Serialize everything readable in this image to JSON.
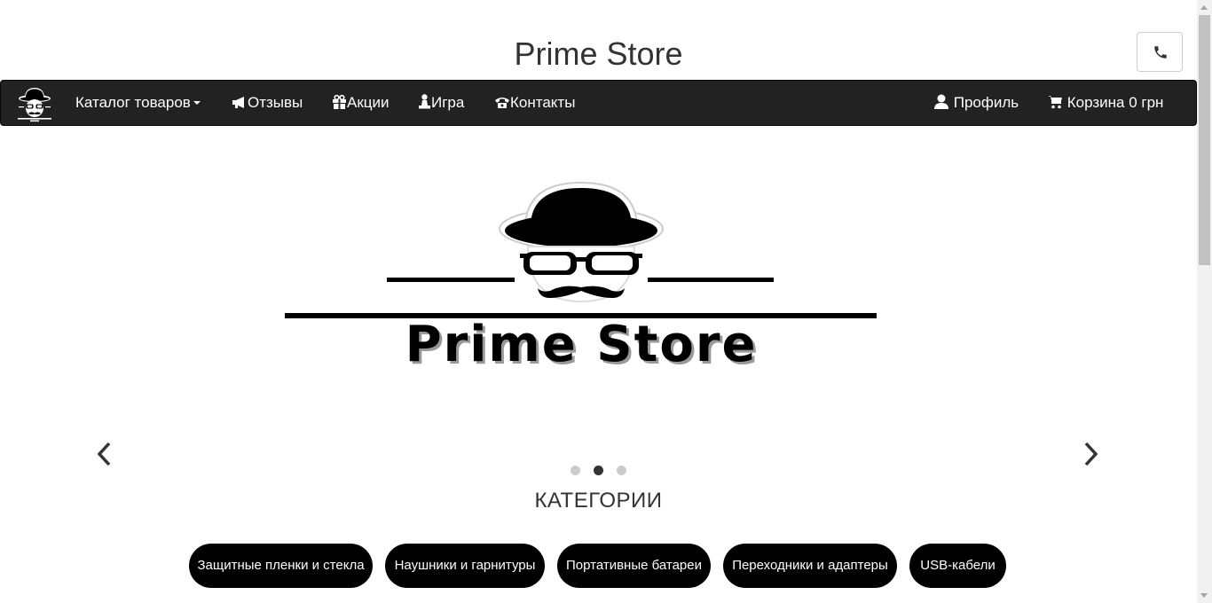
{
  "header": {
    "site_title": "Prime Store",
    "phone_icon": "phone-icon"
  },
  "navbar": {
    "logo_icon": "hat-glasses-mustache-logo-icon",
    "items": [
      {
        "label": "Каталог товаров",
        "icon": "",
        "dropdown": true
      },
      {
        "label": "Отзывы",
        "icon": "megaphone-icon"
      },
      {
        "label": "Акции",
        "icon": "gift-icon"
      },
      {
        "label": "Игра",
        "icon": "pawn-icon"
      },
      {
        "label": "Контакты",
        "icon": "phone-alt-icon"
      }
    ],
    "right": {
      "profile_label": "Профиль",
      "profile_icon": "user-icon",
      "cart_label": "Корзина 0 грн",
      "cart_icon": "shopping-cart-icon"
    }
  },
  "carousel": {
    "slide_logo_text": "Prime Store",
    "slide_count": 3,
    "active_slide": 2,
    "prev_icon": "chevron-left-icon",
    "next_icon": "chevron-right-icon"
  },
  "categories": {
    "title": "КАТЕГОРИИ",
    "items": [
      "Защитные пленки и стекла",
      "Наушники и гарнитуры",
      "Портативные батареи",
      "Переходники и адаптеры",
      "USB-кабели"
    ]
  },
  "colors": {
    "navbar_bg": "#222222",
    "button_bg": "#000000",
    "indicator_active": "#333333",
    "indicator_inactive": "#cccccc"
  }
}
